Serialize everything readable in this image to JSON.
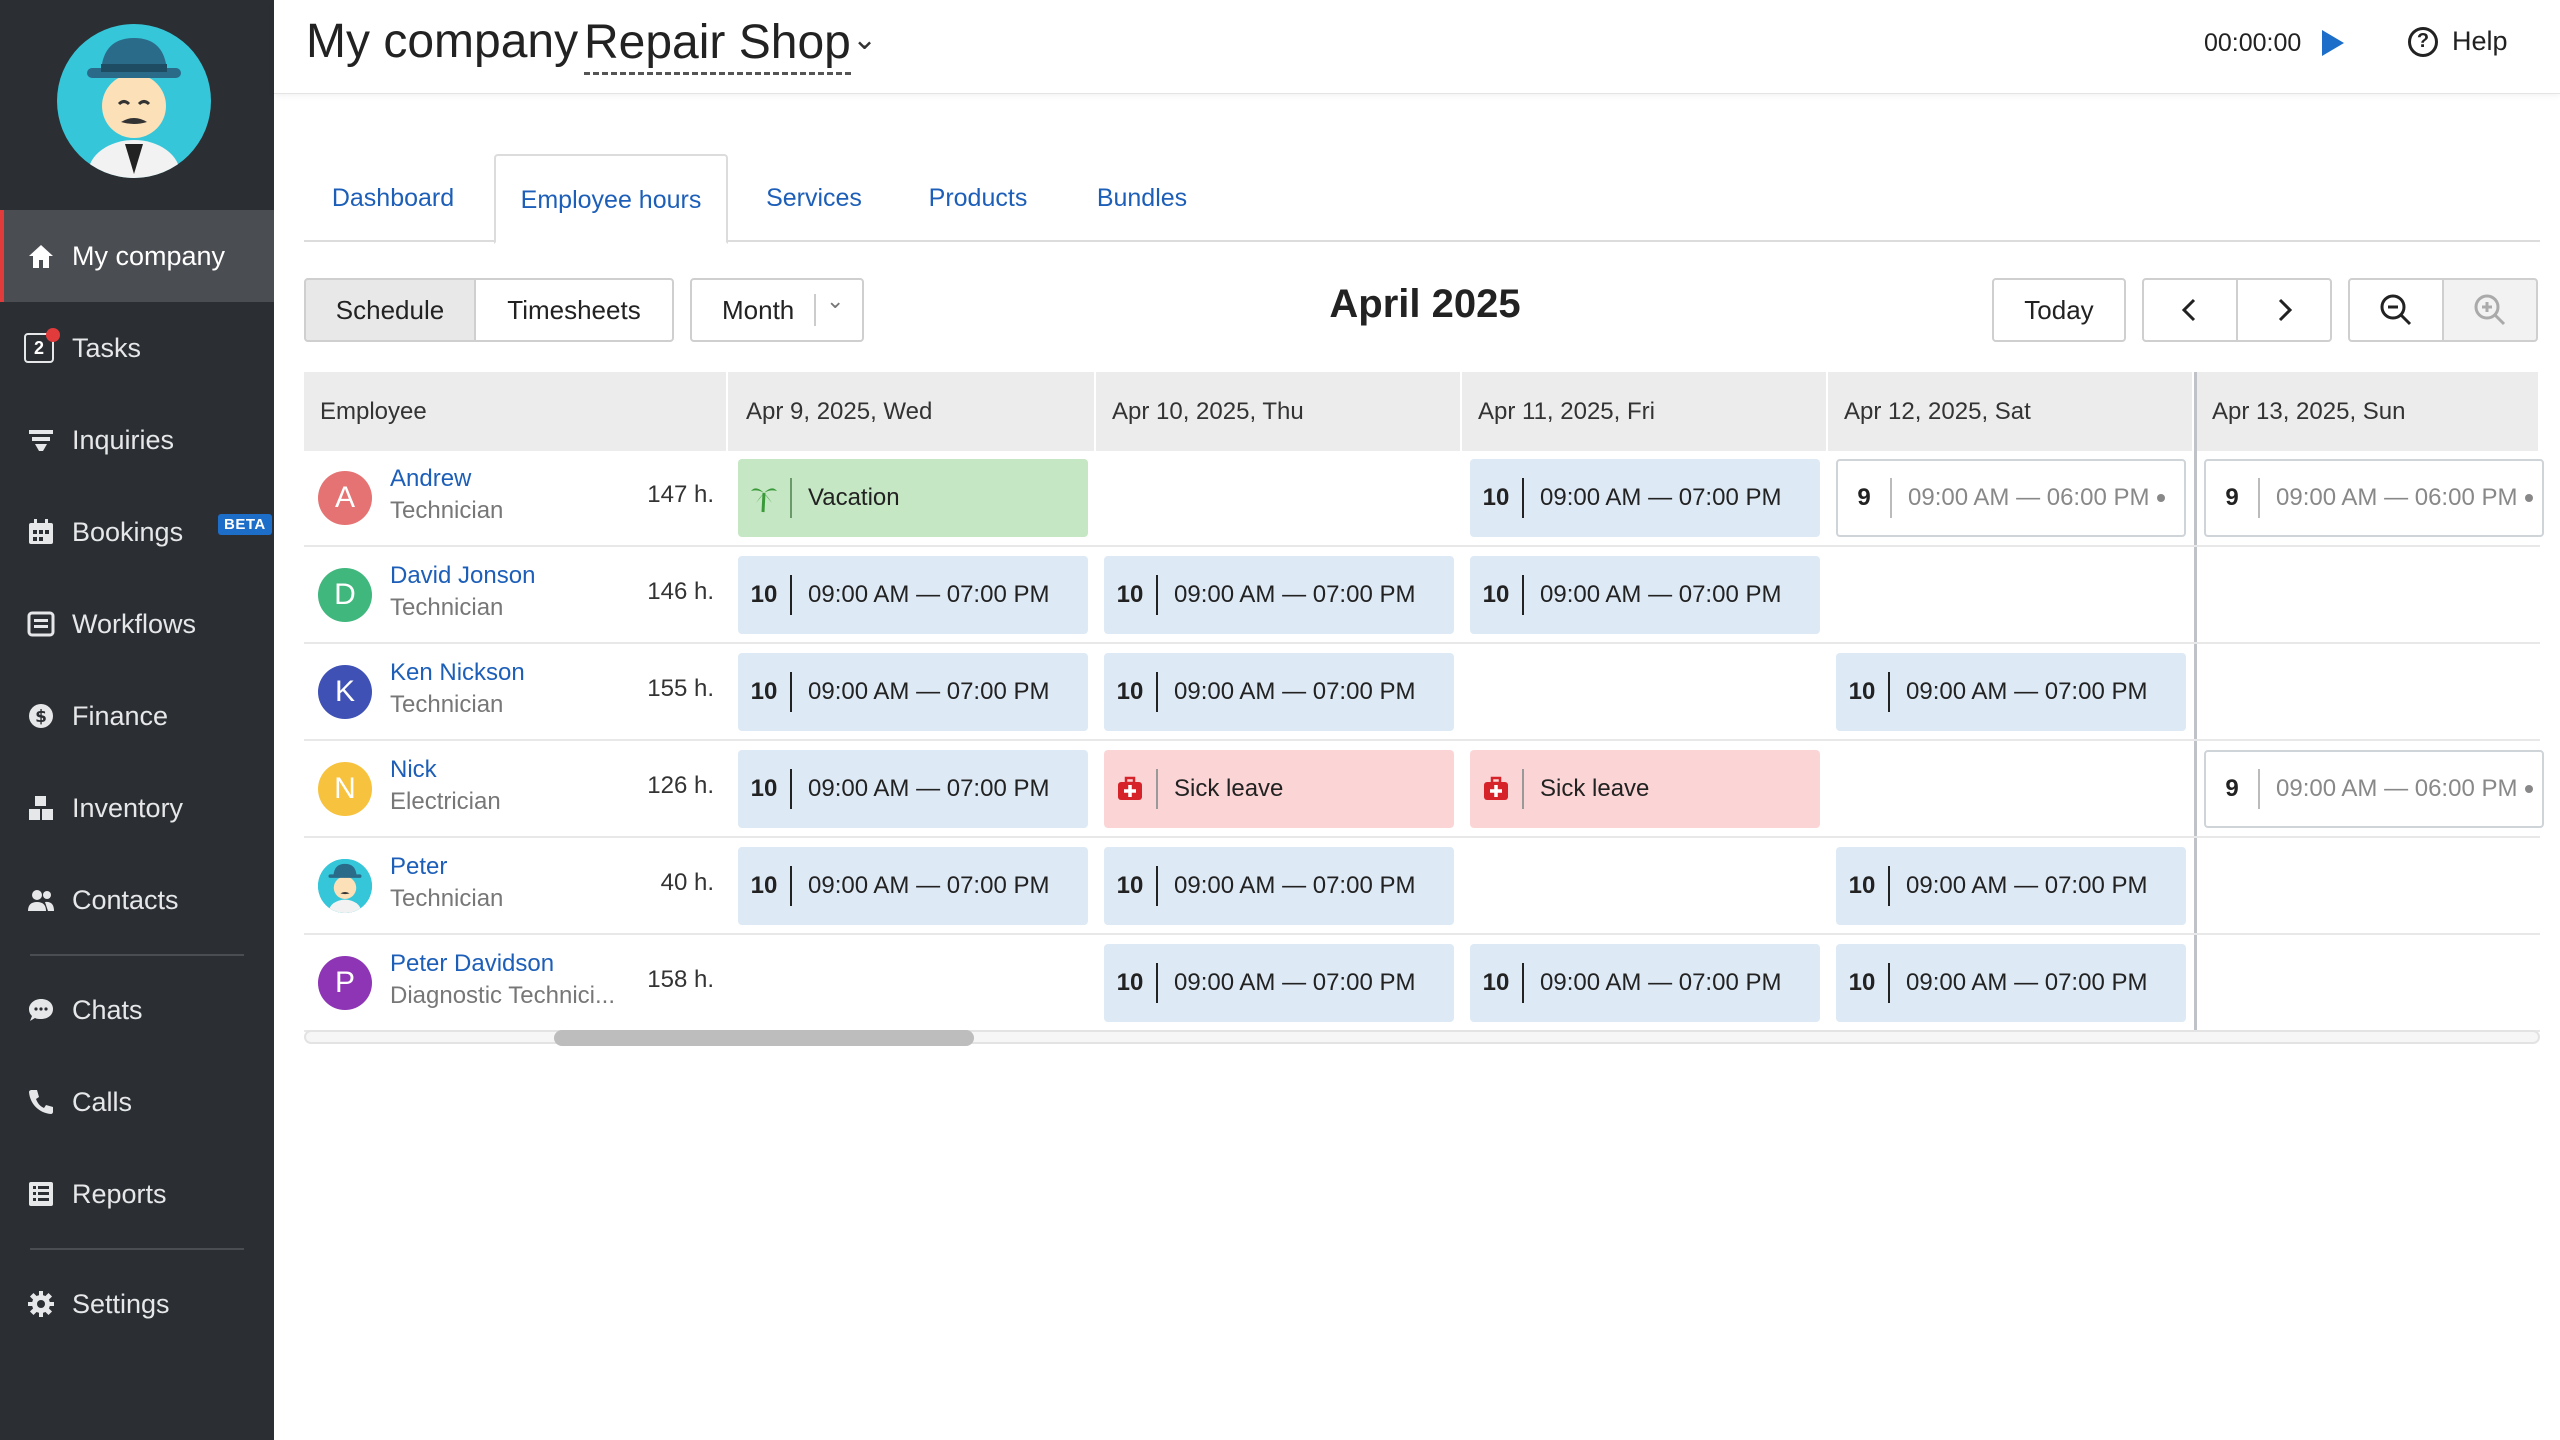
{
  "sidebar": {
    "items": [
      {
        "label": "My company",
        "icon": "home-icon"
      },
      {
        "label": "Tasks",
        "icon": "tasks-icon",
        "badge": "2"
      },
      {
        "label": "Inquiries",
        "icon": "funnel-icon"
      },
      {
        "label": "Bookings",
        "icon": "calendar-icon",
        "tag": "BETA"
      },
      {
        "label": "Workflows",
        "icon": "workflow-icon"
      },
      {
        "label": "Finance",
        "icon": "dollar-icon"
      },
      {
        "label": "Inventory",
        "icon": "boxes-icon"
      },
      {
        "label": "Contacts",
        "icon": "people-icon"
      },
      {
        "label": "Chats",
        "icon": "chat-icon"
      },
      {
        "label": "Calls",
        "icon": "phone-icon"
      },
      {
        "label": "Reports",
        "icon": "reports-icon"
      },
      {
        "label": "Settings",
        "icon": "gear-icon"
      }
    ]
  },
  "header": {
    "company": "My company",
    "shop": "Repair Shop",
    "timer": "00:00:00",
    "help": "Help"
  },
  "tabs": [
    "Dashboard",
    "Employee hours",
    "Services",
    "Products",
    "Bundles"
  ],
  "toolbar": {
    "schedule": "Schedule",
    "timesheets": "Timesheets",
    "view": "Month",
    "title": "April 2025",
    "today": "Today"
  },
  "grid": {
    "employee_header": "Employee",
    "days": [
      "Apr 9, 2025, Wed",
      "Apr 10, 2025, Thu",
      "Apr 11, 2025, Fri",
      "Apr 12, 2025, Sat",
      "Apr 13, 2025, Sun"
    ],
    "rows": [
      {
        "initial": "A",
        "color": "#e57373",
        "name": "Andrew",
        "role": "Technician",
        "hours": "147 h.",
        "cells": [
          {
            "type": "vacation",
            "label": "Vacation"
          },
          null,
          {
            "type": "shift",
            "num": "10",
            "time": "09:00 AM — 07:00 PM"
          },
          {
            "type": "outline",
            "num": "9",
            "time": "09:00 AM — 06:00 PM"
          },
          {
            "type": "outline",
            "num": "9",
            "time": "09:00 AM — 06:00 PM"
          }
        ]
      },
      {
        "initial": "D",
        "color": "#3fb77d",
        "name": "David Jonson",
        "role": "Technician",
        "hours": "146 h.",
        "cells": [
          {
            "type": "shift",
            "num": "10",
            "time": "09:00 AM — 07:00 PM"
          },
          {
            "type": "shift",
            "num": "10",
            "time": "09:00 AM — 07:00 PM"
          },
          {
            "type": "shift",
            "num": "10",
            "time": "09:00 AM — 07:00 PM"
          },
          null,
          null
        ]
      },
      {
        "initial": "K",
        "color": "#3f51b5",
        "name": "Ken Nickson",
        "role": "Technician",
        "hours": "155 h.",
        "cells": [
          {
            "type": "shift",
            "num": "10",
            "time": "09:00 AM — 07:00 PM"
          },
          {
            "type": "shift",
            "num": "10",
            "time": "09:00 AM — 07:00 PM"
          },
          null,
          {
            "type": "shift",
            "num": "10",
            "time": "09:00 AM — 07:00 PM"
          },
          null
        ]
      },
      {
        "initial": "N",
        "color": "#f7c23e",
        "name": "Nick",
        "role": "Electrician",
        "hours": "126 h.",
        "cells": [
          {
            "type": "shift",
            "num": "10",
            "time": "09:00 AM — 07:00 PM"
          },
          {
            "type": "sick",
            "label": "Sick leave"
          },
          {
            "type": "sick",
            "label": "Sick leave"
          },
          null,
          {
            "type": "outline",
            "num": "9",
            "time": "09:00 AM — 06:00 PM"
          }
        ]
      },
      {
        "initial": "",
        "color": "#35c6d9",
        "name": "Peter",
        "role": "Technician",
        "hours": "40 h.",
        "cells": [
          {
            "type": "shift",
            "num": "10",
            "time": "09:00 AM — 07:00 PM"
          },
          {
            "type": "shift",
            "num": "10",
            "time": "09:00 AM — 07:00 PM"
          },
          null,
          {
            "type": "shift",
            "num": "10",
            "time": "09:00 AM — 07:00 PM"
          },
          null
        ]
      },
      {
        "initial": "P",
        "color": "#8e35b5",
        "name": "Peter Davidson",
        "role": "Diagnostic Technici...",
        "hours": "158 h.",
        "cells": [
          null,
          {
            "type": "shift",
            "num": "10",
            "time": "09:00 AM — 07:00 PM"
          },
          {
            "type": "shift",
            "num": "10",
            "time": "09:00 AM — 07:00 PM"
          },
          {
            "type": "shift",
            "num": "10",
            "time": "09:00 AM — 07:00 PM"
          },
          null
        ]
      }
    ]
  }
}
